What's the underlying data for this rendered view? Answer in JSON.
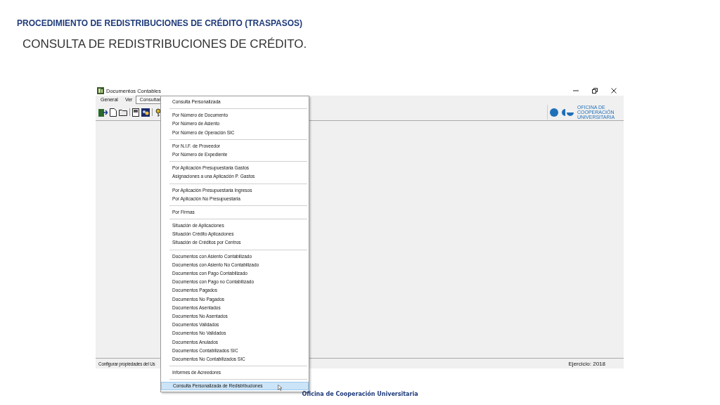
{
  "slide": {
    "title": "PROCEDIMIENTO DE REDISTRIBUCIONES DE CRÉDITO (TRASPASOS)",
    "subtitle": "CONSULTA DE REDISTRIBUCIONES DE CRÉDITO.",
    "footer": "Oficina de Cooperación Universitaria"
  },
  "window": {
    "title": "Documentos Contables",
    "logo_text": "OFICINA DE COOPERACIÓN UNIVERSITARIA"
  },
  "menu_bar": [
    {
      "label": "General",
      "selected": false
    },
    {
      "label": "Ver",
      "selected": false
    },
    {
      "label": "Consultas",
      "selected": true
    }
  ],
  "menu_groups": [
    {
      "items": [
        {
          "label": "Consulta Personalizada",
          "selected": false
        }
      ]
    },
    {
      "items": [
        {
          "label": "Por Número de Documento",
          "selected": false
        },
        {
          "label": "Por Número de Asiento",
          "selected": false
        },
        {
          "label": "Por Número de Operación SIC",
          "selected": false
        }
      ]
    },
    {
      "items": [
        {
          "label": "Por N.I.F. de Proveedor",
          "selected": false
        },
        {
          "label": "Por Número de Expediente",
          "selected": false
        }
      ]
    },
    {
      "items": [
        {
          "label": "Por Aplicación Presupuestaria Gastos",
          "selected": false
        },
        {
          "label": "Asignaciones a una Aplicación P. Gastos",
          "selected": false
        }
      ]
    },
    {
      "items": [
        {
          "label": "Por Aplicación Presupuestaria Ingresos",
          "selected": false
        },
        {
          "label": "Por Aplicación No Presupuestaria",
          "selected": false
        }
      ]
    },
    {
      "items": [
        {
          "label": "Por Firmas",
          "selected": false
        }
      ]
    },
    {
      "items": [
        {
          "label": "Situación de Aplicaciones",
          "selected": false
        },
        {
          "label": "Situación Crédito Aplicaciones",
          "selected": false
        },
        {
          "label": "Situación de Créditos por Centros",
          "selected": false
        }
      ]
    },
    {
      "items": [
        {
          "label": "Documentos con Asiento Contabilizado",
          "selected": false
        },
        {
          "label": "Documentos con Asiento No Contabilizado",
          "selected": false
        },
        {
          "label": "Documentos con Pago Contabilizado",
          "selected": false
        },
        {
          "label": "Documentos con Pago no Contabilizado",
          "selected": false
        },
        {
          "label": "Documentos Pagados",
          "selected": false
        },
        {
          "label": "Documentos No Pagados",
          "selected": false
        },
        {
          "label": "Documentos Asentados",
          "selected": false
        },
        {
          "label": "Documentos No Asentados",
          "selected": false
        },
        {
          "label": "Documentos Validados",
          "selected": false
        },
        {
          "label": "Documentos No Validados",
          "selected": false
        },
        {
          "label": "Documentos Anulados",
          "selected": false
        },
        {
          "label": "Documentos Contabilizados SIC",
          "selected": false
        },
        {
          "label": "Documentos No Contabilizados SIC",
          "selected": false
        }
      ]
    },
    {
      "items": [
        {
          "label": "Informes de Acreedores",
          "selected": false
        }
      ]
    },
    {
      "items": [
        {
          "label": "Consulta Personalizada de Redistribuciones",
          "selected": true
        }
      ]
    }
  ],
  "status_bar": {
    "left": "Configurar propiedades del Us",
    "right": "Ejercicio: 2018"
  }
}
